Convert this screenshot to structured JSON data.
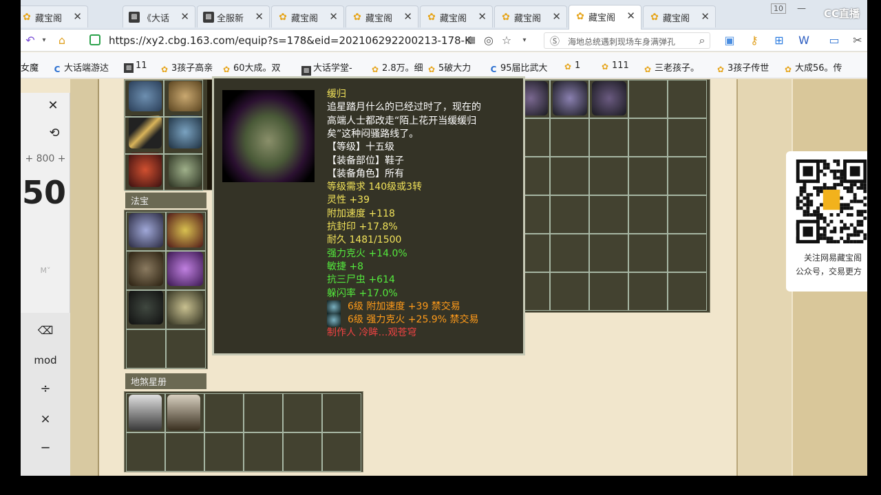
{
  "browser": {
    "tabs": [
      {
        "label": "藏宝阁",
        "icon": "cbg-logo-icon",
        "active": false
      },
      {
        "label": "《大话",
        "icon": "game-icon",
        "active": false
      },
      {
        "label": "全服新",
        "icon": "game-icon",
        "active": false
      },
      {
        "label": "藏宝阁",
        "icon": "cbg-logo-icon",
        "active": false
      },
      {
        "label": "藏宝阁",
        "icon": "cbg-logo-icon",
        "active": false
      },
      {
        "label": "藏宝阁",
        "icon": "cbg-logo-icon",
        "active": false
      },
      {
        "label": "藏宝阁",
        "icon": "cbg-logo-icon",
        "active": false
      },
      {
        "label": "藏宝阁",
        "icon": "cbg-logo-icon",
        "active": true
      },
      {
        "label": "藏宝阁",
        "icon": "cbg-logo-icon",
        "active": false
      }
    ],
    "window_badge": "10",
    "url": "https://xy2.cbg.163.com/equip?s=178&eid=202106292200213-178-K",
    "search_text": "海地总统遇刺现场车身满弹孔",
    "bookmarks": [
      {
        "label": "女魔",
        "icon": "none"
      },
      {
        "label": "大话端游达",
        "icon": "c-logo-icon"
      },
      {
        "label": "11",
        "icon": "game-icon"
      },
      {
        "label": "3孩子高亲",
        "icon": "cbg-logo-icon"
      },
      {
        "label": "60大成。双",
        "icon": "cbg-logo-icon"
      },
      {
        "label": "大话学堂-",
        "icon": "game-icon"
      },
      {
        "label": "2.8万。细",
        "icon": "cbg-logo-icon"
      },
      {
        "label": "5破大力",
        "icon": "cbg-logo-icon"
      },
      {
        "label": "95届比武大",
        "icon": "c-logo-icon"
      },
      {
        "label": "1",
        "icon": "cbg-logo-icon"
      },
      {
        "label": "111",
        "icon": "cbg-logo-icon"
      },
      {
        "label": "三老孩子。",
        "icon": "cbg-logo-icon"
      },
      {
        "label": "3孩子传世",
        "icon": "cbg-logo-icon"
      },
      {
        "label": "大成56。传",
        "icon": "cbg-logo-icon"
      }
    ]
  },
  "calculator": {
    "expression": "+ 800 +",
    "result": "50",
    "memory": "M˅",
    "keys": [
      "⌫",
      "mod",
      "÷",
      "×",
      "−"
    ]
  },
  "page": {
    "section_fabao": "法宝",
    "section_dishaxingce": "地煞星册"
  },
  "tooltip": {
    "name": "缓归",
    "desc": [
      "追星踏月什么的已经过时了，现在的",
      "高端人士都改走“陌上花开当缓缓归",
      "矣”这种闷骚路线了。"
    ],
    "level": "【等级】十五级",
    "slot": "【装备部位】鞋子",
    "role": "【装备角色】所有",
    "req": "等级需求 140级或3转",
    "stats_yellow": [
      "灵性 +39",
      "附加速度 +118",
      "抗封印 +17.8%",
      "耐久 1481/1500"
    ],
    "stats_green": [
      "强力克火 +14.0%",
      "敏捷 +8",
      "抗三尸虫 +614",
      "躲闪率 +17.0%"
    ],
    "gems": [
      "6级 附加速度 +39 禁交易",
      "6级 强力克火 +25.9% 禁交易"
    ],
    "maker": "制作人 冷眸…观苍穹"
  },
  "qr_card": {
    "line1": "关注网易藏宝阁",
    "line2": "公众号，交易更方"
  },
  "watermark": "CC直播"
}
